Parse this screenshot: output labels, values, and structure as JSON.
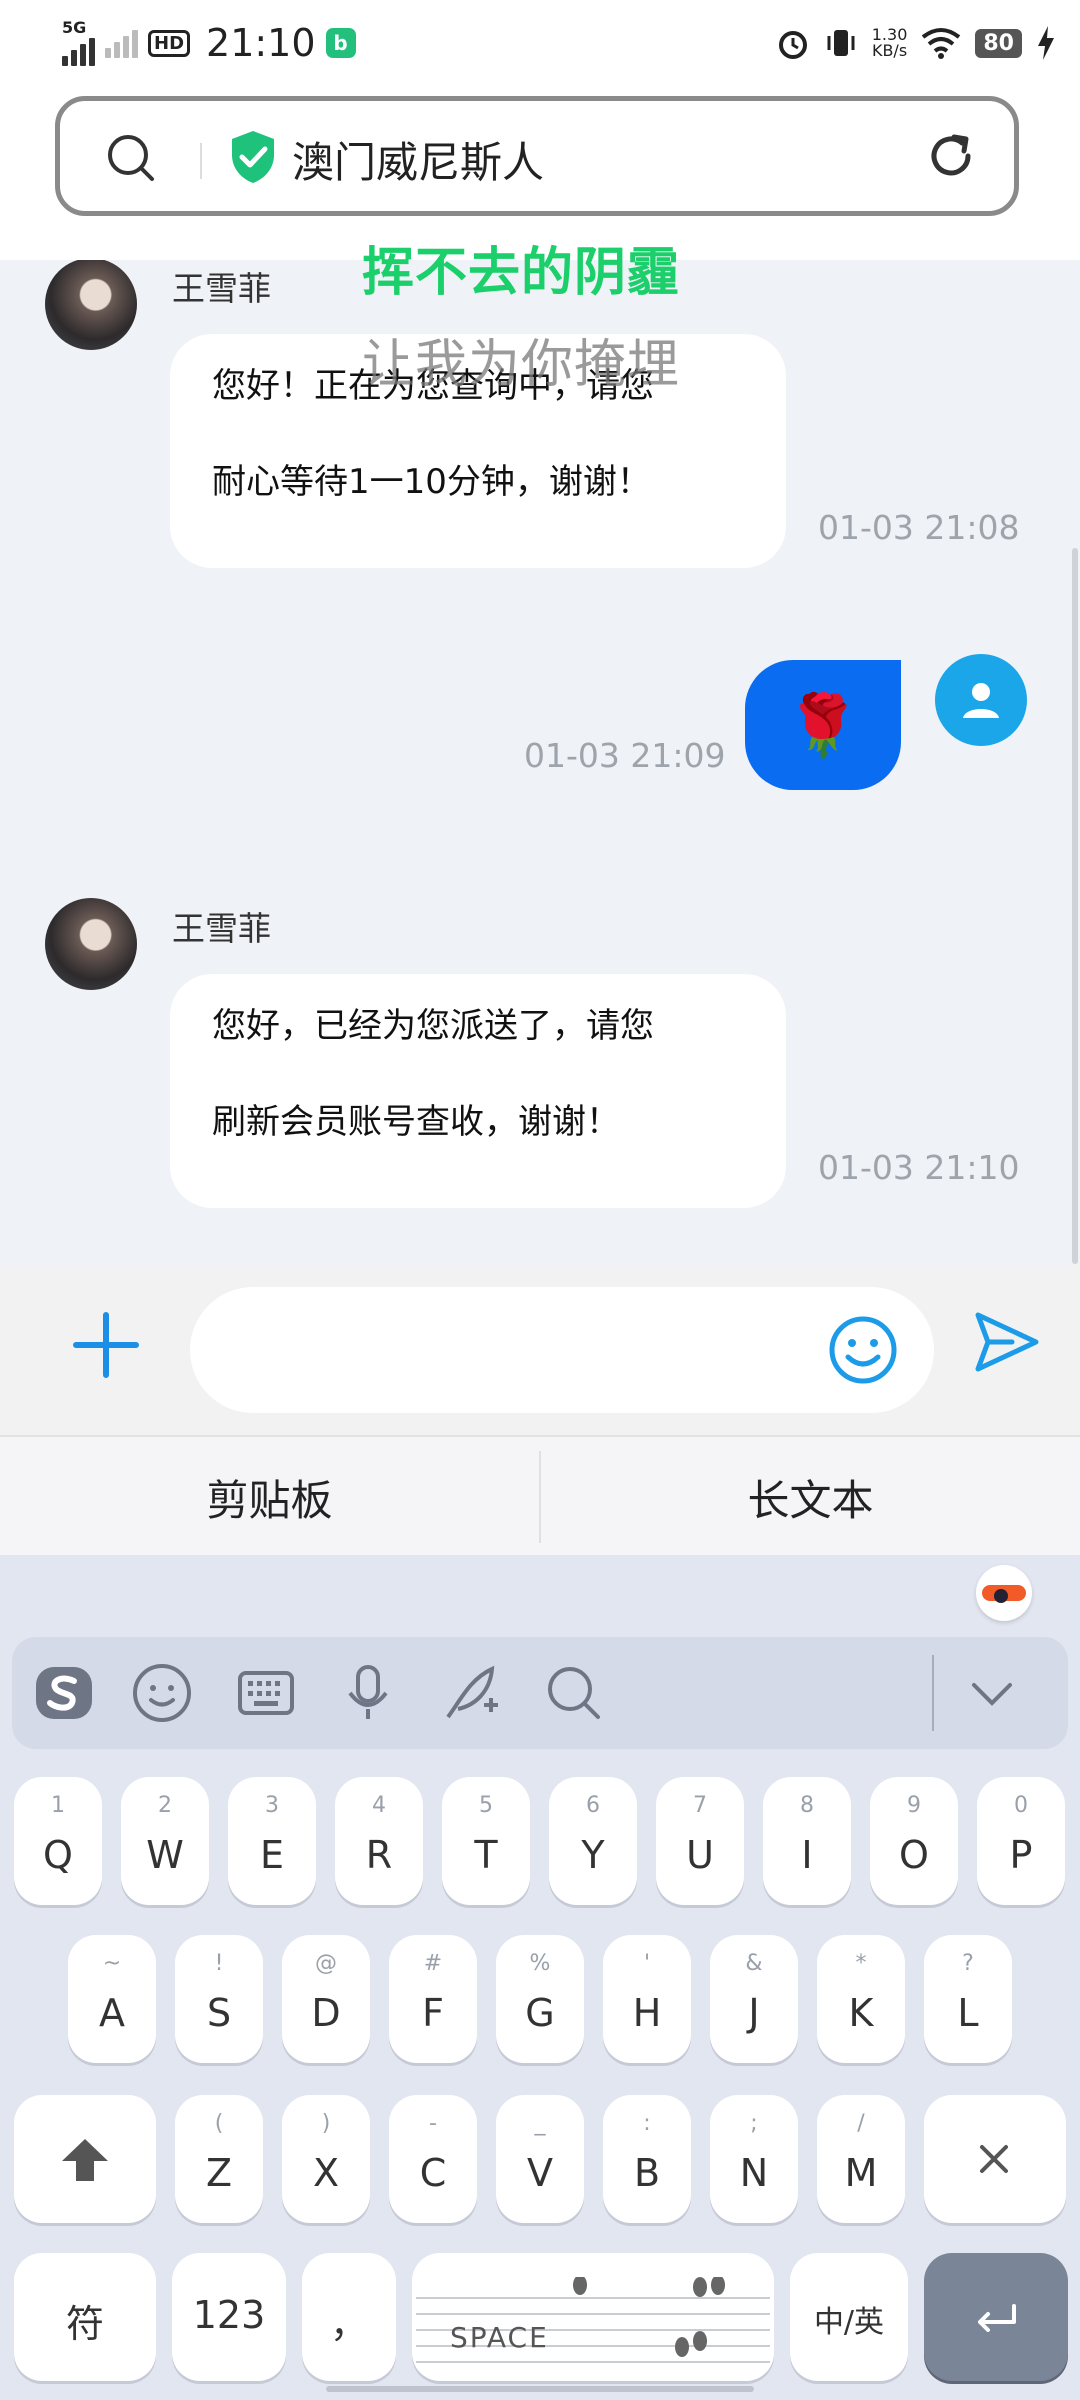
{
  "status_bar": {
    "network": "5G",
    "hd": "HD",
    "time": "21:10",
    "app_badge": "b",
    "speed_value": "1.30",
    "speed_unit": "KB/s",
    "battery": "80"
  },
  "address_bar": {
    "title": "澳门威尼斯人"
  },
  "overlay_lyrics": [
    "挥不去的阴霾",
    "让我为你掩埋"
  ],
  "messages": [
    {
      "sender": "王雪菲",
      "lines": [
        "您好！正在为您查询中，请您",
        "耐心等待1一10分钟，谢谢！"
      ],
      "time": "01-03 21:08"
    },
    {
      "sender": "me",
      "emoji": "🌹",
      "time": "01-03 21:09"
    },
    {
      "sender": "王雪菲",
      "lines": [
        "您好，已经为您派送了，请您",
        "刷新会员账号查收，谢谢！"
      ],
      "time": "01-03 21:10"
    }
  ],
  "clipboard_strip": {
    "clipboard": "剪贴板",
    "long_text": "长文本"
  },
  "keyboard": {
    "row1": [
      {
        "main": "Q",
        "sub": "1"
      },
      {
        "main": "W",
        "sub": "2"
      },
      {
        "main": "E",
        "sub": "3"
      },
      {
        "main": "R",
        "sub": "4"
      },
      {
        "main": "T",
        "sub": "5"
      },
      {
        "main": "Y",
        "sub": "6"
      },
      {
        "main": "U",
        "sub": "7"
      },
      {
        "main": "I",
        "sub": "8"
      },
      {
        "main": "O",
        "sub": "9"
      },
      {
        "main": "P",
        "sub": "0"
      }
    ],
    "row2": [
      {
        "main": "A",
        "sub": "~"
      },
      {
        "main": "S",
        "sub": "!"
      },
      {
        "main": "D",
        "sub": "@"
      },
      {
        "main": "F",
        "sub": "#"
      },
      {
        "main": "G",
        "sub": "%"
      },
      {
        "main": "H",
        "sub": "'"
      },
      {
        "main": "J",
        "sub": "&"
      },
      {
        "main": "K",
        "sub": "*"
      },
      {
        "main": "L",
        "sub": "?"
      }
    ],
    "row3": [
      {
        "main": "Z",
        "sub": "("
      },
      {
        "main": "X",
        "sub": ")"
      },
      {
        "main": "C",
        "sub": "-"
      },
      {
        "main": "V",
        "sub": "_"
      },
      {
        "main": "B",
        "sub": ":"
      },
      {
        "main": "N",
        "sub": ";"
      },
      {
        "main": "M",
        "sub": "/"
      }
    ],
    "symbols": "符",
    "numbers": "123",
    "punct": "，",
    "space": "SPACE",
    "lang": "中/英"
  }
}
